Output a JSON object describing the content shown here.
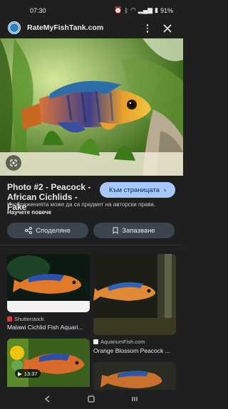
{
  "status": {
    "time": "07:30",
    "battery": "91%"
  },
  "header": {
    "site_name": "RateMyFishTank.com"
  },
  "detail": {
    "title": "Photo #2 - Peacock - African Cichlids - Fake",
    "visit_label": "Към страницата",
    "notice_text": "Изображенията може да са предмет на авторски права.",
    "notice_link": "Научете повече",
    "share_label": "Споделяне",
    "save_label": "Запазване"
  },
  "results": [
    {
      "source": "Shutterstock",
      "title": "Malawi Cichlid Fish Aquari..."
    },
    {
      "source": "AquariumFish.com",
      "title": "Orange Blossom Peacock ..."
    },
    {
      "duration": "13:37"
    }
  ]
}
